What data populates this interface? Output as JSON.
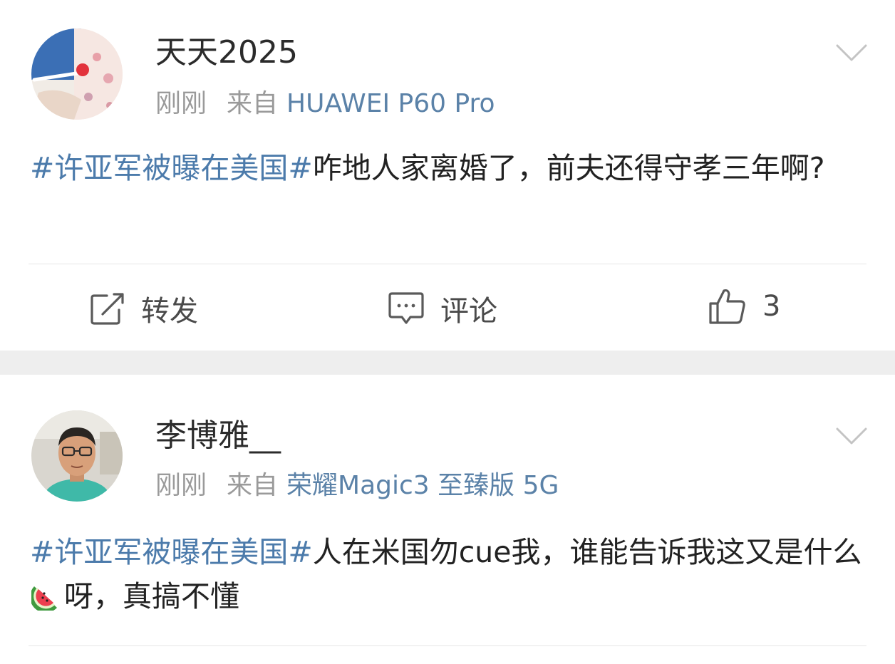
{
  "posts": [
    {
      "username": "天天2025",
      "time": "刚刚",
      "from_label": "来自",
      "device": "HUAWEI P60 Pro",
      "topic": "#许亚军被曝在美国#",
      "text_before_emoji": "咋地人家离婚了，前夫还得守孝三年啊?",
      "text_after_emoji": "",
      "actions": {
        "repost": "转发",
        "comment": "评论",
        "likes": "3"
      }
    },
    {
      "username": "李博雅__",
      "time": "刚刚",
      "from_label": "来自",
      "device": "荣耀Magic3 至臻版 5G",
      "topic": "#许亚军被曝在美国#",
      "text_before_emoji": "人在米国勿cue我，谁能告诉我这又是什么",
      "emoji": "watermelon-emoji",
      "text_after_emoji": "呀，真搞不懂"
    }
  ],
  "colors": {
    "topic": "#4c7bab",
    "device": "#5b82a8",
    "meta": "#9a9a9a",
    "separator": "#eeeeee"
  }
}
